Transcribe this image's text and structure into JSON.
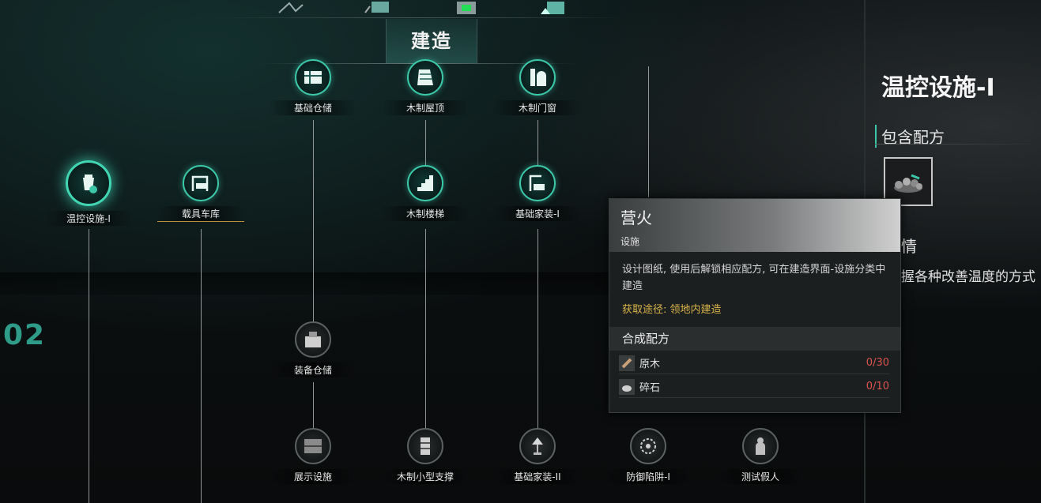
{
  "top_tabs": {
    "active_label": "建造"
  },
  "side_number": "02",
  "nodes": {
    "warm": "温控设施-I",
    "garage": "载具车库",
    "basic_storage": "基础仓储",
    "wood_roof": "木制屋顶",
    "wood_door": "木制门窗",
    "wood_stairs": "木制楼梯",
    "basic_home1": "基础家装-I",
    "gear_storage": "装备仓储",
    "display": "展示设施",
    "wood_support": "木制小型支撑",
    "basic_home2": "基础家装-II",
    "trap": "防御陷阱-I",
    "dummy": "测试假人"
  },
  "panel": {
    "title": "温控设施-I",
    "section_recipes": "包含配方",
    "section_desc_partial": "情",
    "desc_partial": "握各种改善温度的方式"
  },
  "tooltip": {
    "name": "营火",
    "type": "设施",
    "description": "设计图纸, 使用后解锁相应配方, 可在建造界面-设施分类中建造",
    "source": "获取途径: 领地内建造",
    "recipe_header": "合成配方",
    "materials": [
      {
        "name": "原木",
        "count": "0/30"
      },
      {
        "name": "碎石",
        "count": "0/10"
      }
    ]
  },
  "colors": {
    "accent": "#3cc7a9",
    "gold": "#b8903c",
    "warning": "#d9534f",
    "source": "#d9b54a"
  }
}
